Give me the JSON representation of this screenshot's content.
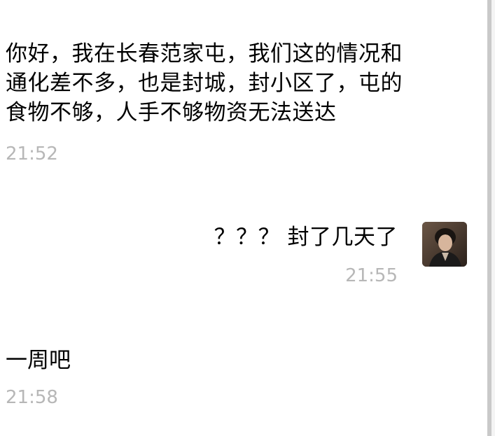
{
  "messages": [
    {
      "direction": "incoming",
      "text": "你好，我在长春范家屯，我们这的情况和通化差不多，也是封城，封小区了，屯的食物不够，人手不够物资无法送达",
      "time": "21:52"
    },
    {
      "direction": "outgoing",
      "text": "？？？ 封了几天了",
      "time": "21:55",
      "avatar": "user-avatar-photo"
    },
    {
      "direction": "incoming",
      "text": "一周吧",
      "time": "21:58"
    }
  ],
  "colors": {
    "background": "#ffffff",
    "text": "#000000",
    "timestamp": "#b7b7b7",
    "scrollbar": "#c9c9c9"
  }
}
